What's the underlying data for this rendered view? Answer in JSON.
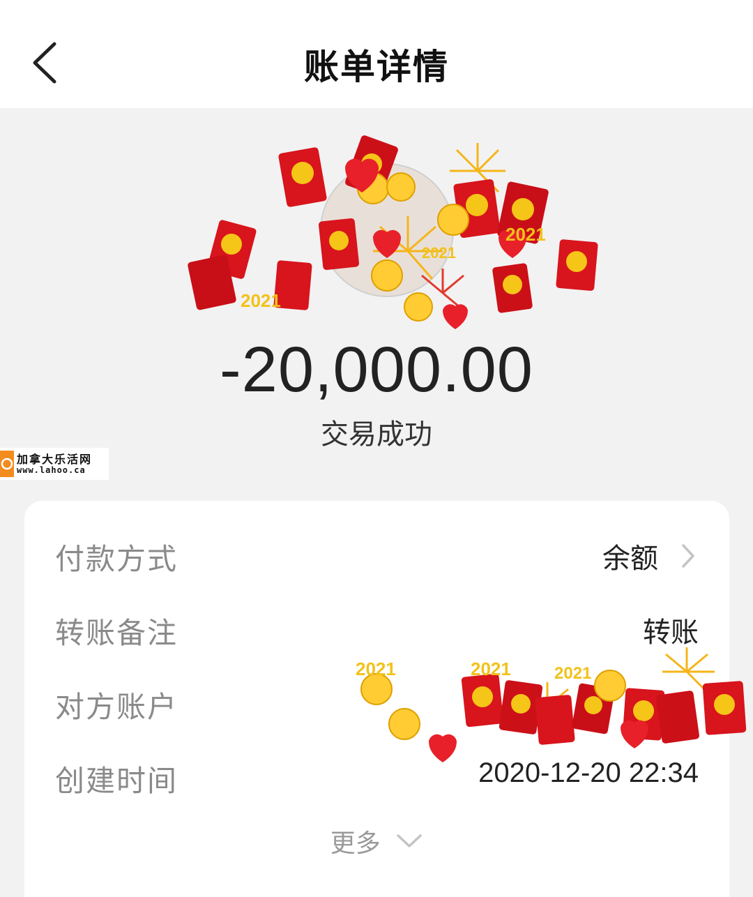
{
  "header": {
    "title": "账单详情"
  },
  "transaction": {
    "amount": "-20,000.00",
    "status": "交易成功"
  },
  "watermark": {
    "name": "加拿大乐活网",
    "url": "www.lahoo.ca"
  },
  "details": {
    "payment_method": {
      "label": "付款方式",
      "value": "余额"
    },
    "remark": {
      "label": "转账备注",
      "value": "转账"
    },
    "counterparty": {
      "label": "对方账户",
      "value": ""
    },
    "created_time": {
      "label": "创建时间",
      "value": "2020-12-20 22:34"
    }
  },
  "more": {
    "label": "更多"
  },
  "colors": {
    "header_bg": "#ffffff",
    "page_bg": "#f2f2f2",
    "card_bg": "#ffffff",
    "label_gray": "#8a8a8a",
    "red_envelope": "#d8141c",
    "gold": "#f5c518"
  },
  "icons": {
    "back": "chevron-left-icon",
    "row_chevron": "chevron-right-icon",
    "more_chevron": "chevron-down-icon",
    "sticker": "red-envelope-fireworks-sticker"
  }
}
